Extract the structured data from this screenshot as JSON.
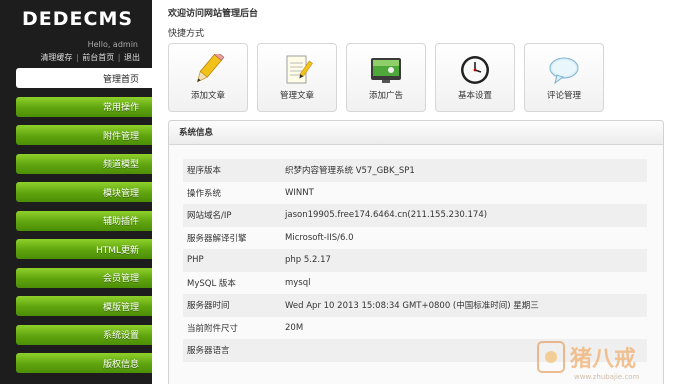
{
  "sidebar": {
    "logo": "DEDECMS",
    "hello": "Hello, admin",
    "links": [
      "清理缓存",
      "前台首页",
      "退出"
    ],
    "menu": [
      {
        "label": "管理首页",
        "active": true
      },
      {
        "label": "常用操作"
      },
      {
        "label": "附件管理"
      },
      {
        "label": "频道模型"
      },
      {
        "label": "模块管理"
      },
      {
        "label": "辅助插件"
      },
      {
        "label": "HTML更新"
      },
      {
        "label": "会员管理"
      },
      {
        "label": "模版管理"
      },
      {
        "label": "系统设置"
      },
      {
        "label": "版权信息"
      }
    ]
  },
  "main": {
    "welcome": "欢迎访问网站管理后台",
    "shortcut_title": "快捷方式",
    "shortcuts": [
      {
        "label": "添加文章",
        "icon": "pencil-icon"
      },
      {
        "label": "管理文章",
        "icon": "notepad-icon"
      },
      {
        "label": "添加广告",
        "icon": "ad-monitor-icon"
      },
      {
        "label": "基本设置",
        "icon": "clock-icon"
      },
      {
        "label": "评论管理",
        "icon": "speech-bubble-icon"
      }
    ],
    "sysinfo": {
      "title": "系统信息",
      "rows": [
        {
          "k": "程序版本",
          "v": "织梦内容管理系统 V57_GBK_SP1"
        },
        {
          "k": "操作系统",
          "v": "WINNT"
        },
        {
          "k": "网站域名/IP",
          "v": "jason19905.free174.6464.cn(211.155.230.174)"
        },
        {
          "k": "服务器解译引擎",
          "v": "Microsoft-IIS/6.0"
        },
        {
          "k": "PHP",
          "v": "php 5.2.17"
        },
        {
          "k": "MySQL 版本",
          "v": "mysql"
        },
        {
          "k": "服务器时间",
          "v": "Wed Apr 10 2013 15:08:34 GMT+0800 (中国标准时间) 星期三"
        },
        {
          "k": "当前附件尺寸",
          "v": "20M"
        },
        {
          "k": "服务器语言",
          "v": ""
        }
      ]
    }
  },
  "watermark": {
    "text": "猪八戒",
    "url": "www.zhubajie.com"
  }
}
